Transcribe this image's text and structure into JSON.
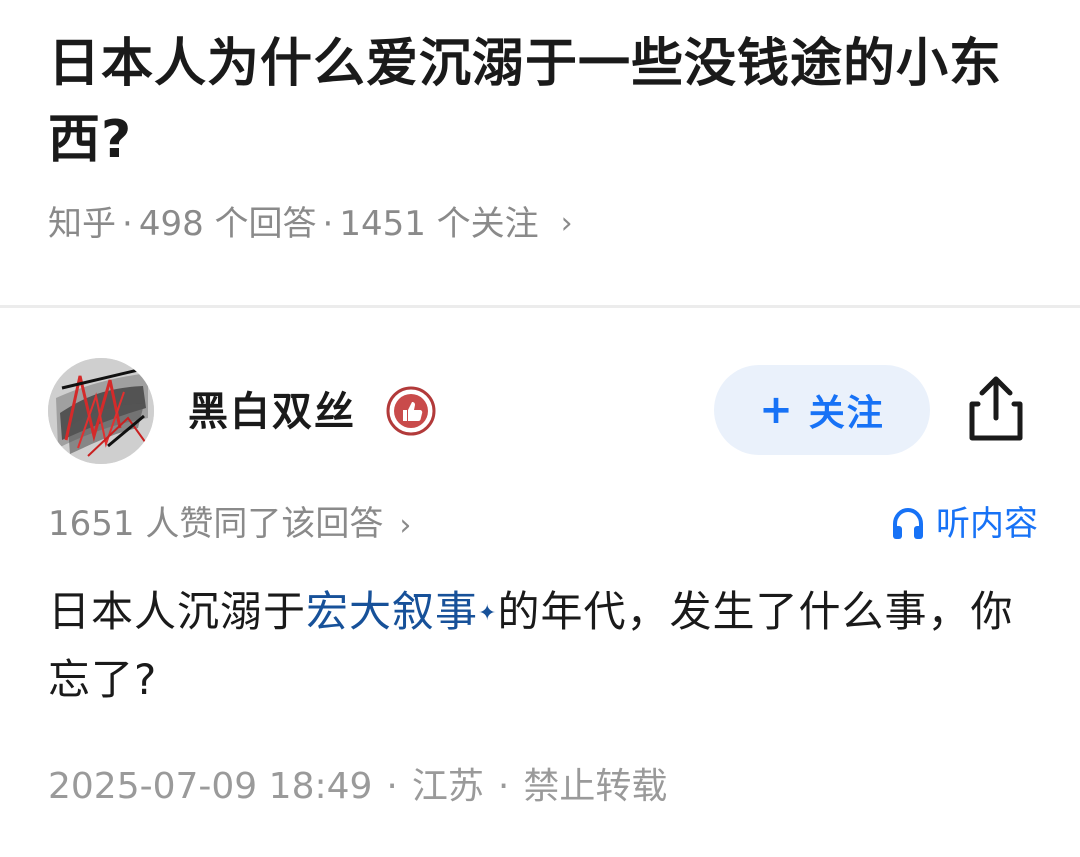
{
  "question": {
    "title": "日本人为什么爱沉溺于一些没钱途的小东西?",
    "source": "知乎",
    "answers_count": "498 个回答",
    "followers_count": "1451 个关注",
    "separator": "·",
    "chevron": "›"
  },
  "author": {
    "name": "黑白双丝",
    "avatar_icon": "abstract-ink-avatar",
    "badge_icon": "thumbs-up-badge-icon",
    "follow_label": "关注",
    "follow_plus": "+",
    "share_icon": "share-icon"
  },
  "stats": {
    "upvotes_text": "1651 人赞同了该回答",
    "chevron": "›",
    "listen_label": "听内容",
    "listen_icon": "headphones-icon"
  },
  "answer": {
    "text_before": "日本人沉溺于",
    "link_text": "宏大叙事",
    "link_marker": "✦",
    "text_after": "的年代，发生了什么事，你忘了?"
  },
  "footer": {
    "datetime": "2025-07-09 18:49",
    "location": "江苏",
    "copyright": "禁止转载",
    "separator": "·"
  },
  "colors": {
    "accent_blue": "#1772f6",
    "link_blue": "#175199",
    "follow_bg": "#eaf1fb",
    "meta_gray": "#8a8a8a",
    "badge_red": "#c94b4b"
  }
}
